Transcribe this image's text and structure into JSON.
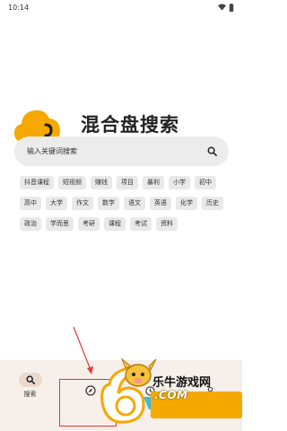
{
  "status_bar": {
    "time": "10:14"
  },
  "app": {
    "title": "混合盘搜索"
  },
  "search": {
    "placeholder": "输入关键词搜索"
  },
  "tags": [
    "抖音课程",
    "短视频",
    "赚钱",
    "项目",
    "暴利",
    "小学",
    "初中",
    "高中",
    "大学",
    "作文",
    "数学",
    "语文",
    "英语",
    "化学",
    "历史",
    "政治",
    "学而思",
    "考研",
    "课程",
    "考试",
    "资料"
  ],
  "nav": {
    "search_label": "搜索"
  },
  "watermark": {
    "brand": "乐牛游戏网",
    "url": ".COM"
  },
  "colors": {
    "accent": "#f5a800",
    "nav_bg": "#f6efea",
    "annotation": "#e53935"
  }
}
